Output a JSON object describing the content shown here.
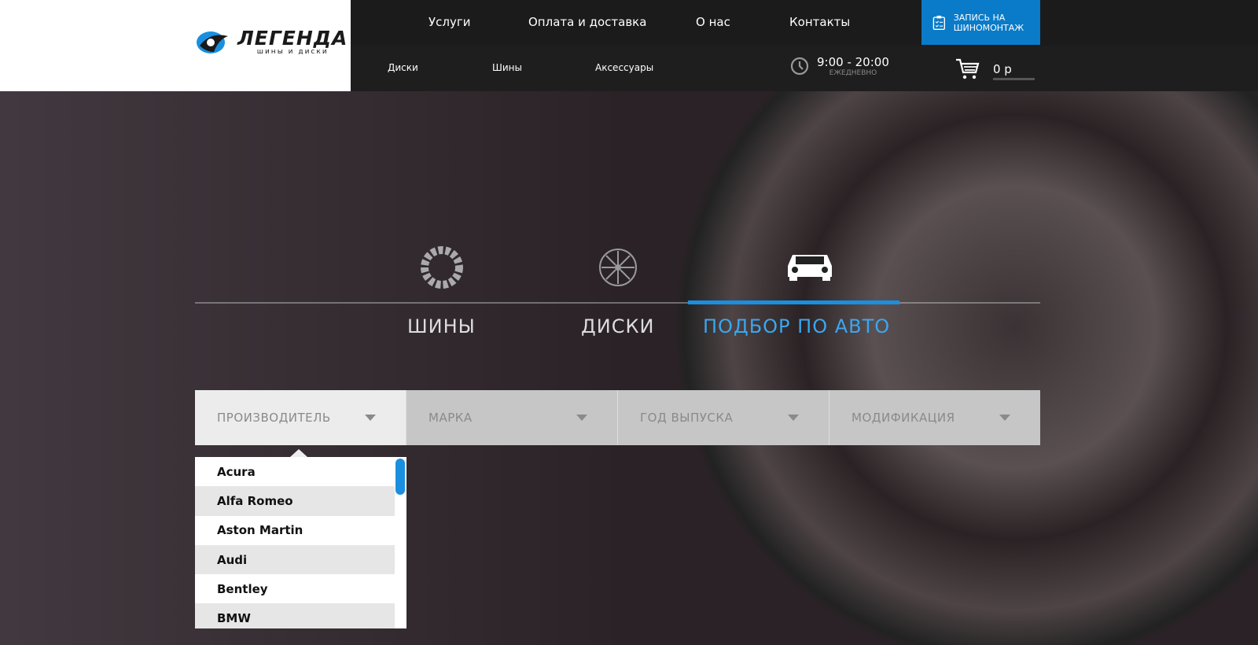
{
  "logo": {
    "title": "ЛЕГЕНДА",
    "subtitle": "шины и диски"
  },
  "nav_main": [
    "Услуги",
    "Оплата и доставка",
    "О нас",
    "Контакты"
  ],
  "nav_sub": [
    "Диски",
    "Шины",
    "Аксессуары"
  ],
  "cta": {
    "label": "ЗАПИСЬ НА ШИНОМОНТАЖ",
    "icon": "clipboard-check-icon"
  },
  "hours": {
    "time": "9:00 - 20:00",
    "note": "ЕЖЕДНЕВНО"
  },
  "cart": {
    "total": "0 р"
  },
  "tabs": [
    {
      "label": "ШИНЫ",
      "icon": "tire-icon"
    },
    {
      "label": "ДИСКИ",
      "icon": "rim-icon"
    },
    {
      "label": "ПОДБОР ПО АВТО",
      "icon": "car-icon",
      "active": true
    }
  ],
  "filters": [
    "ПРОИЗВОДИТЕЛЬ",
    "МАРКА",
    "ГОД ВЫПУСКА",
    "МОДИФИКАЦИЯ"
  ],
  "manufacturers": [
    "Acura",
    "Alfa Romeo",
    "Aston Martin",
    "Audi",
    "Bentley",
    "BMW"
  ],
  "colors": {
    "accent": "#1a8fe0",
    "cta": "#0a7bc8"
  }
}
